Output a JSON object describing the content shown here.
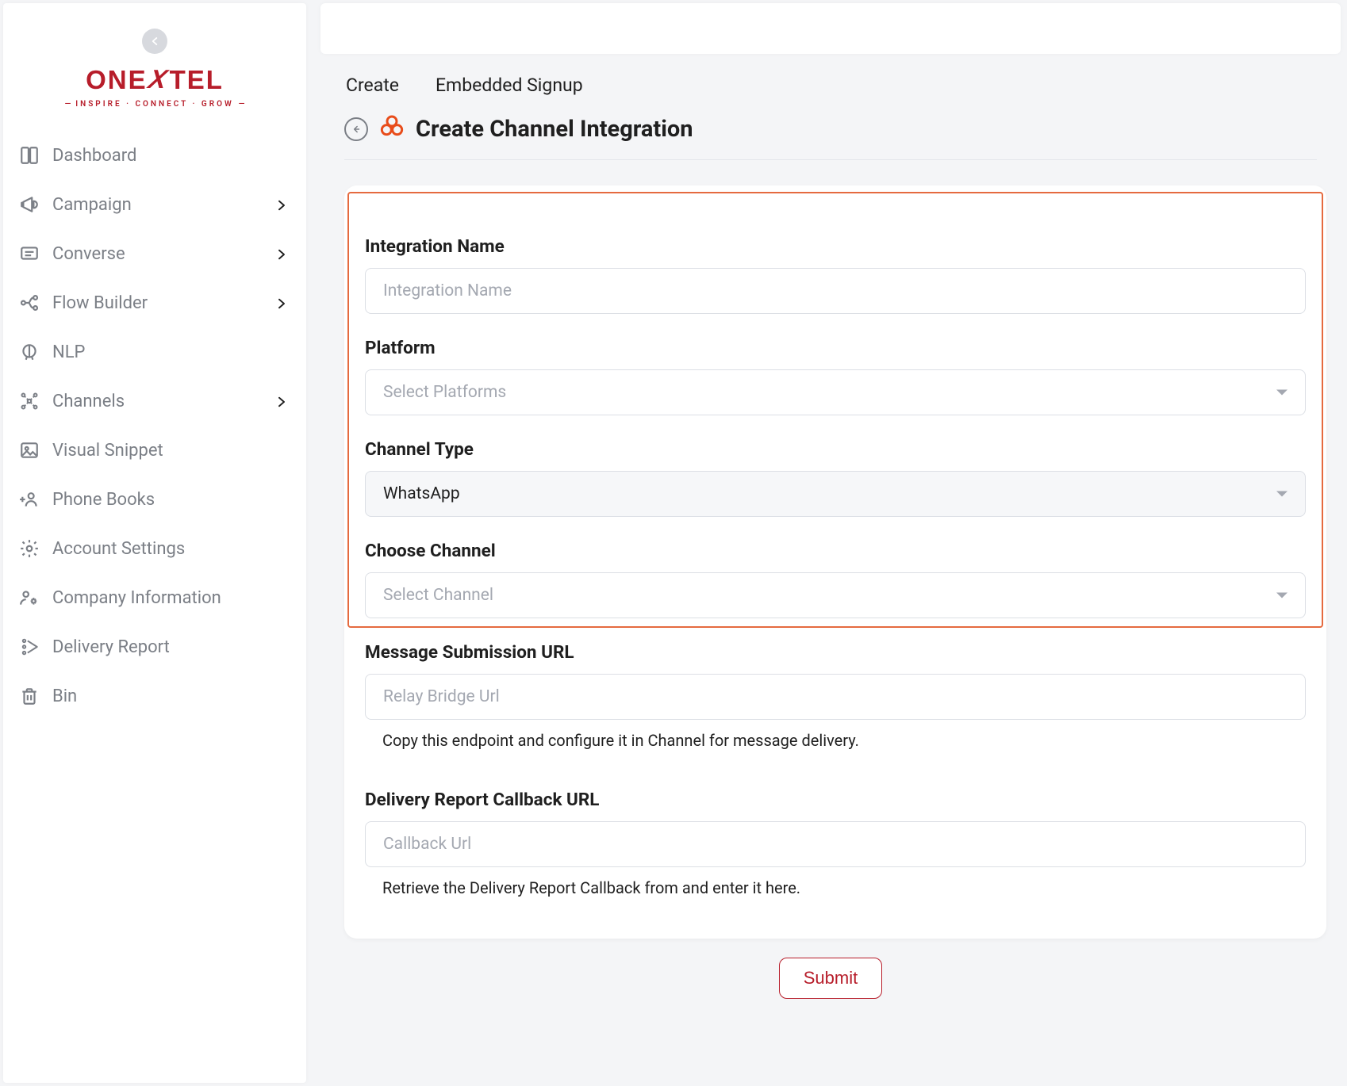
{
  "brand": {
    "name_parts": [
      "ONE",
      "X",
      "TEL"
    ],
    "tagline": "INSPIRE · CONNECT · GROW"
  },
  "sidebar": {
    "items": [
      {
        "label": "Dashboard",
        "icon": "dashboard",
        "has_children": false
      },
      {
        "label": "Campaign",
        "icon": "megaphone",
        "has_children": true
      },
      {
        "label": "Converse",
        "icon": "chat",
        "has_children": true
      },
      {
        "label": "Flow Builder",
        "icon": "flow",
        "has_children": true
      },
      {
        "label": "NLP",
        "icon": "brain",
        "has_children": false
      },
      {
        "label": "Channels",
        "icon": "channels",
        "has_children": true
      },
      {
        "label": "Visual Snippet",
        "icon": "image",
        "has_children": false
      },
      {
        "label": "Phone Books",
        "icon": "person-add",
        "has_children": false
      },
      {
        "label": "Account Settings",
        "icon": "gear",
        "has_children": false
      },
      {
        "label": "Company Information",
        "icon": "people-gear",
        "has_children": false
      },
      {
        "label": "Delivery Report",
        "icon": "send-report",
        "has_children": false
      },
      {
        "label": "Bin",
        "icon": "trash",
        "has_children": false
      }
    ]
  },
  "tabs": [
    {
      "label": "Create"
    },
    {
      "label": "Embedded Signup"
    }
  ],
  "page": {
    "title": "Create Channel Integration"
  },
  "form": {
    "integration_name": {
      "label": "Integration Name",
      "placeholder": "Integration Name",
      "value": ""
    },
    "platform": {
      "label": "Platform",
      "placeholder": "Select Platforms"
    },
    "channel_type": {
      "label": "Channel Type",
      "value": "WhatsApp"
    },
    "choose_channel": {
      "label": "Choose Channel",
      "placeholder": "Select Channel"
    },
    "message_url": {
      "label": "Message Submission URL",
      "placeholder": "Relay Bridge Url",
      "value": "",
      "help": "Copy this endpoint and configure it in Channel for message delivery."
    },
    "callback_url": {
      "label": "Delivery Report Callback URL",
      "placeholder": "Callback Url",
      "value": "",
      "help": "Retrieve the Delivery Report Callback from and enter it here."
    },
    "submit_label": "Submit"
  }
}
